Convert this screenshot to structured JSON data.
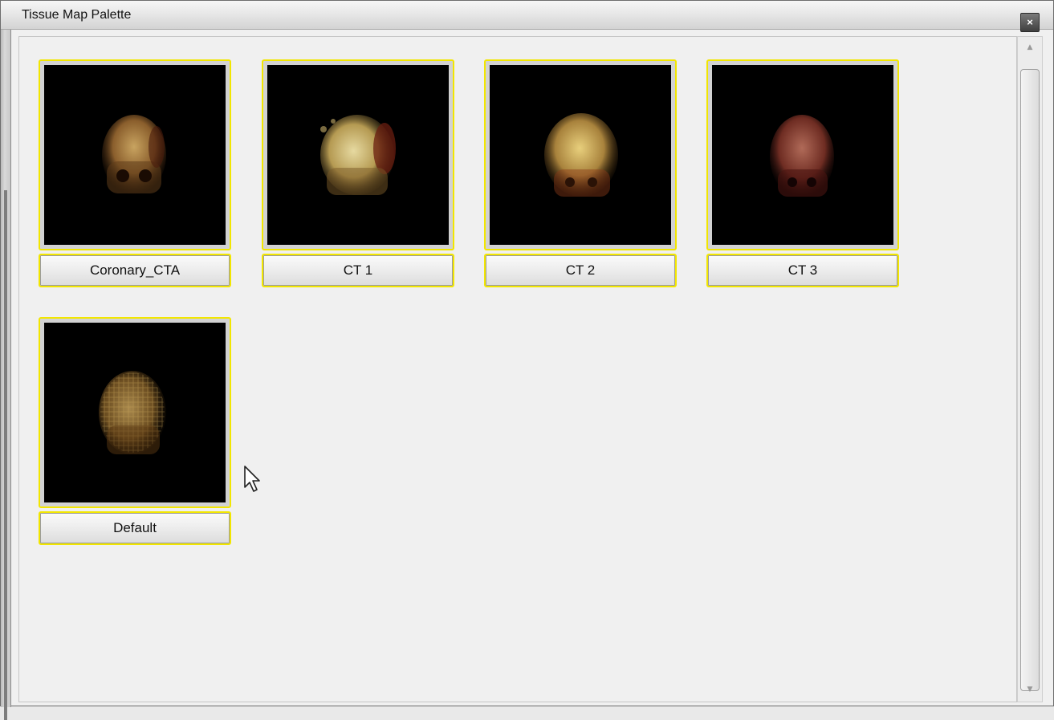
{
  "window": {
    "title": "Tissue Map Palette",
    "close_glyph": "×"
  },
  "palette": {
    "items": [
      {
        "label": "Coronary_CTA",
        "tone": "warm"
      },
      {
        "label": "CT 1",
        "tone": "bright"
      },
      {
        "label": "CT 2",
        "tone": "bright"
      },
      {
        "label": "CT 3",
        "tone": "reddish"
      },
      {
        "label": "Default",
        "tone": "textured"
      }
    ],
    "highlight_color": "#f2e600"
  },
  "scrollbar": {
    "up_glyph": "▲",
    "down_glyph": "▼"
  }
}
